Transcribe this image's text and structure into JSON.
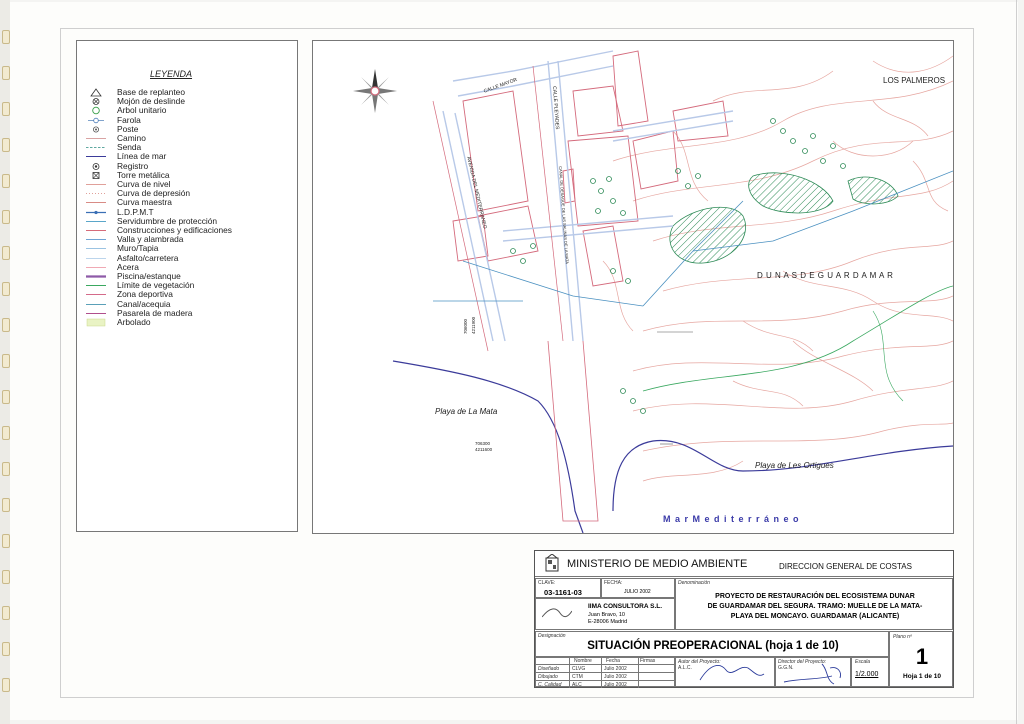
{
  "legend": {
    "title": "LEYENDA",
    "items": [
      {
        "label": "Base de replanteo",
        "icon": "triangle-icon",
        "color": "#333333"
      },
      {
        "label": "Mojón de deslinde",
        "icon": "circle-x-icon",
        "color": "#333333"
      },
      {
        "label": "Arbol unitario",
        "icon": "tree-icon",
        "color": "#3aa04a"
      },
      {
        "label": "Farola",
        "icon": "streetlight-icon",
        "color": "#4a7bb7"
      },
      {
        "label": "Poste",
        "icon": "pole-icon",
        "color": "#555555"
      },
      {
        "label": "Camino",
        "icon": "line-icon",
        "color": "#d9a3a3"
      },
      {
        "label": "Senda",
        "icon": "dashed-line-icon",
        "color": "#5fa8a0"
      },
      {
        "label": "Línea de mar",
        "icon": "line-icon",
        "color": "#3b3b9a"
      },
      {
        "label": "Registro",
        "icon": "dot-circle-icon",
        "color": "#333333"
      },
      {
        "label": "Torre metálica",
        "icon": "box-x-icon",
        "color": "#333333"
      },
      {
        "label": "Curva de nivel",
        "icon": "line-icon",
        "color": "#e0a09a"
      },
      {
        "label": "Curva de depresión",
        "icon": "dotted-line-icon",
        "color": "#e0a09a"
      },
      {
        "label": "Curva maestra",
        "icon": "line-icon",
        "color": "#d88b85"
      },
      {
        "label": "L.D.P.M.T",
        "icon": "ldpmt-line-icon",
        "color": "#3a6fb5"
      },
      {
        "label": "Servidumbre de protección",
        "icon": "line-icon",
        "color": "#5aa6c9"
      },
      {
        "label": "Construcciones y edificaciones",
        "icon": "line-icon",
        "color": "#d66b7a"
      },
      {
        "label": "Valla y alambrada",
        "icon": "line-icon",
        "color": "#6fa3d4"
      },
      {
        "label": "Muro/Tapia",
        "icon": "line-icon",
        "color": "#9bc3e2"
      },
      {
        "label": "Asfalto/carretera",
        "icon": "line-icon",
        "color": "#bcd5ec"
      },
      {
        "label": "Acera",
        "icon": "line-icon",
        "color": "#f0a9b4"
      },
      {
        "label": "Piscina/estanque",
        "icon": "thick-line-icon",
        "color": "#8e5aa8"
      },
      {
        "label": "Límite de vegetación",
        "icon": "line-icon",
        "color": "#3aa860"
      },
      {
        "label": "Zona deportiva",
        "icon": "line-icon",
        "color": "#d46a8a"
      },
      {
        "label": "Canal/acequia",
        "icon": "line-icon",
        "color": "#5aa0b8"
      },
      {
        "label": "Pasarela de madera",
        "icon": "line-icon",
        "color": "#b04e8c"
      },
      {
        "label": "Arbolado",
        "icon": "swatch-icon",
        "color": "#e9f3c4"
      }
    ]
  },
  "map": {
    "labels": {
      "los_palmeros": "LOS PALMEROS",
      "dunas": "D U N A S   D E   G U A R D A M A R",
      "playa_mata": "Playa de La Mata",
      "playa_ortigues": "Playa de Les Ortigues",
      "mar": "M a r           M e d i t e r r á n e o",
      "coord_a": "706300",
      "coord_b": "4211600",
      "coord_side_a": "706000",
      "coord_side_b": "4211900",
      "street_1": "CALLE MAYOR",
      "street_2": "AVENIDA DEL MEDITERRANEO",
      "street_3": "CANAL DE DESAGUE DE LAS SALINAS DE LA MATA",
      "street_4": "CALLE PLEYADES"
    },
    "colors": {
      "contour": "#e6a6a0",
      "buildings": "#d46a7c",
      "vegetation": "#2e8b57",
      "water_line": "#3b3b9a",
      "canal": "#4a90c0",
      "mar_label": "#3a3aa8"
    }
  },
  "title_block": {
    "ministry": "MINISTERIO DE MEDIO AMBIENTE",
    "direction": "DIRECCION GENERAL DE COSTAS",
    "clave_label": "CLAVE:",
    "clave": "03-1161-03",
    "fecha_label": "FECHA:",
    "fecha": "JULIO  2002",
    "denominacion_label": "Denominación",
    "project_line1": "PROYECTO DE RESTAURACIÓN DEL ECOSISTEMA DUNAR",
    "project_line2": "DE GUARDAMAR DEL SEGURA. TRAMO: MUELLE DE LA MATA-",
    "project_line3": "PLAYA DEL MONCAYO. GUARDAMAR (ALICANTE)",
    "company_name": "IIMA CONSULTORA S.L.",
    "company_addr1": "Juan Bravo, 10",
    "company_addr2": "E-28006 Madrid",
    "designacion_label": "Designación",
    "sheet_title": "SITUACIÓN PREOPERACIONAL (hoja 1 de 10)",
    "plano_label": "Plano nº",
    "plano_number": "1",
    "hoja": "Hoja  1  de 10",
    "escala_label": "Escala",
    "escala": "1/2.000",
    "autor_label": "Autor del Proyecto:",
    "autor": "A.L.C.",
    "director_label": "Director del Proyecto:",
    "director": "G.G.N.",
    "table_headers": [
      "Nombre",
      "Fecha",
      "Firmas"
    ],
    "rows": [
      {
        "role": "Diseñado",
        "name": "CLVG",
        "date": "Julio 2002"
      },
      {
        "role": "Dibujado",
        "name": "CTM",
        "date": "Julio 2002"
      },
      {
        "role": "C. Calidad",
        "name": "ALC",
        "date": "Julio 2002"
      }
    ]
  }
}
